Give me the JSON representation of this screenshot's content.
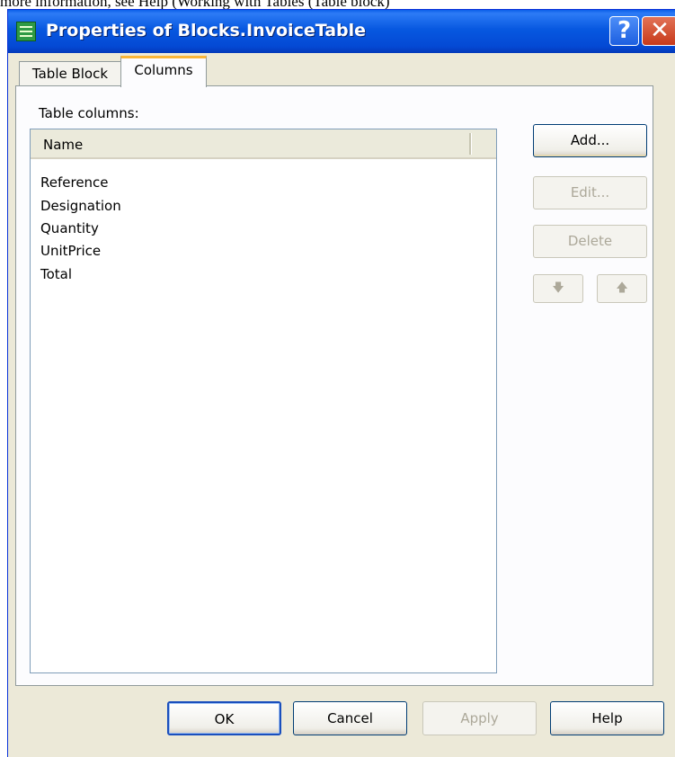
{
  "caption": "more information, see Help (Working with Tables (Table block)",
  "window": {
    "title": "Properties of Blocks.InvoiceTable",
    "help_glyph": "?",
    "close_glyph": "✕"
  },
  "tabs": [
    {
      "label": "Table Block",
      "active": false
    },
    {
      "label": "Columns",
      "active": true
    }
  ],
  "columns_tab": {
    "table_columns_label": "Table columns:",
    "header": {
      "name_label": "Name"
    },
    "items": [
      "Reference",
      "Designation",
      "Quantity",
      "UnitPrice",
      "Total"
    ],
    "buttons": {
      "add": "Add...",
      "edit": "Edit...",
      "delete": "Delete",
      "move_down_glyph": "🡇",
      "move_up_glyph": "🡅"
    }
  },
  "footer": {
    "ok": "OK",
    "cancel": "Cancel",
    "apply": "Apply",
    "help": "Help"
  },
  "colors": {
    "titlebar": "#0758e0",
    "dialog_bg": "#ece9d8",
    "tab_highlight": "#f9b538",
    "disabled_text": "#aca899"
  }
}
